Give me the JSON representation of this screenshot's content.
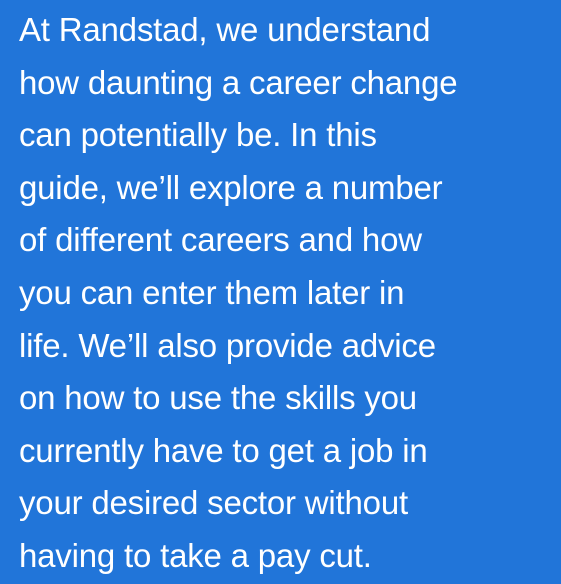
{
  "intro": {
    "lines": [
      "At Randstad, we understand",
      "how daunting a career change",
      "can potentially be. In this",
      "guide, we’ll explore a number",
      "of different careers and how",
      "you can enter them later in",
      "life. We’ll also provide advice",
      "on how to use the skills you",
      "currently have to get a job in",
      "your desired sector without",
      "having to take a pay cut."
    ]
  },
  "colors": {
    "background": "#2175D9",
    "text": "#FFFFFF"
  }
}
